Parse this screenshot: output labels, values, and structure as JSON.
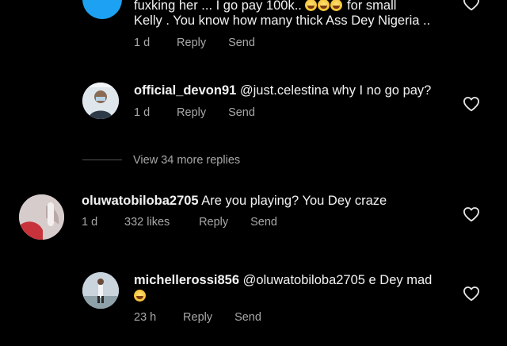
{
  "comments": [
    {
      "line1": "fuxking her ... I go pay 100k.. ",
      "line1_after": " for small",
      "line2": "Kelly .  You know how many thick Ass Dey Nigeria ..",
      "time": "1 d",
      "reply": "Reply",
      "send": "Send"
    },
    {
      "username": "official_devon91",
      "text": " @just.celestina why I no go pay?",
      "time": "1 d",
      "reply": "Reply",
      "send": "Send"
    },
    {
      "view_more": "View 34 more replies"
    },
    {
      "username": "oluwatobiloba2705",
      "text": " Are you playing? You Dey craze",
      "time": "1 d",
      "likes": "332 likes",
      "reply": "Reply",
      "send": "Send"
    },
    {
      "username": "michellerossi856",
      "text": " @oluwatobiloba2705 e Dey mad",
      "time": "23 h",
      "reply": "Reply",
      "send": "Send"
    }
  ],
  "colors": {
    "background": "#000000",
    "text": "#f2f2f2",
    "meta": "#a8a8a8",
    "avatar_blue": "#1da1f2"
  },
  "icons": [
    "heart-icon",
    "grinning-emoji-icon"
  ]
}
